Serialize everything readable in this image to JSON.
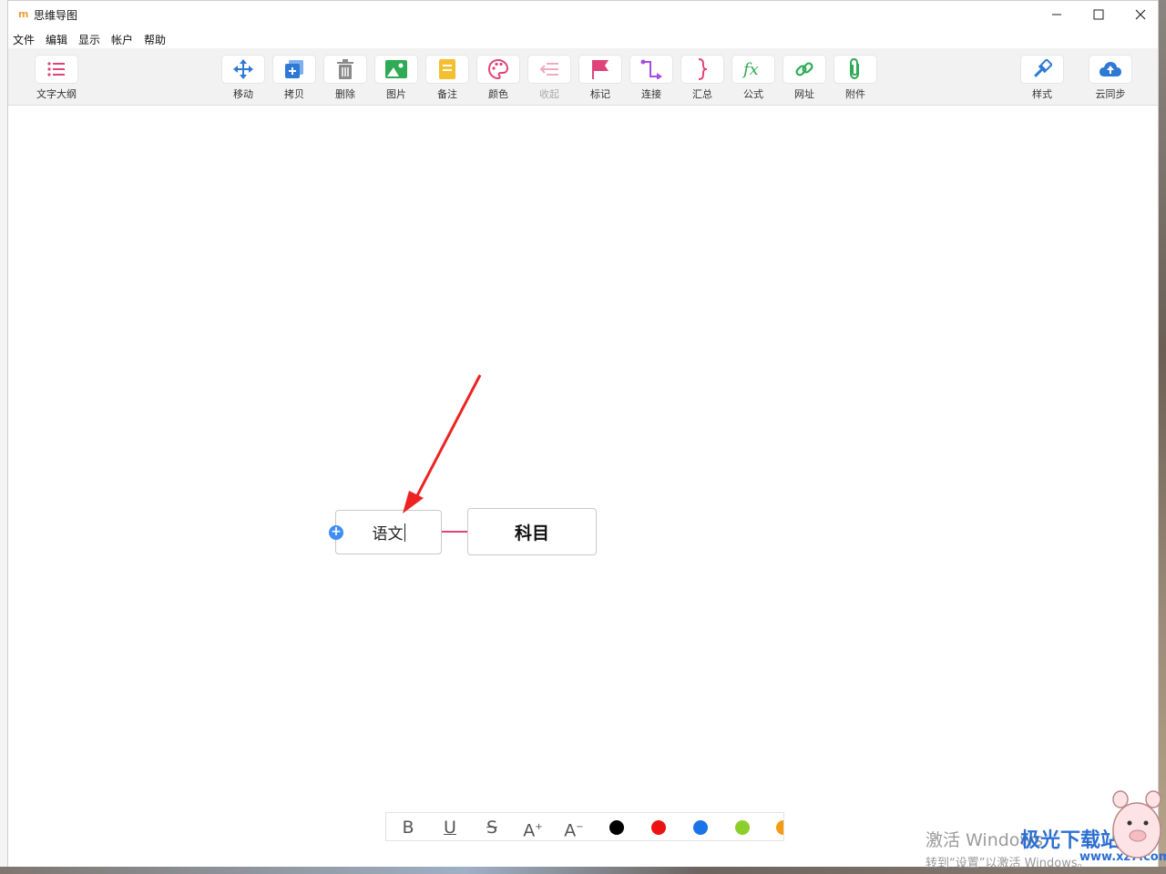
{
  "window": {
    "title": "思维导图",
    "logo": "m",
    "controls": [
      "minimize-icon",
      "maximize-icon",
      "close-icon"
    ]
  },
  "menu": [
    "文件",
    "编辑",
    "显示",
    "帐户",
    "帮助"
  ],
  "toolbar": {
    "outline": "文字大纲",
    "move": "移动",
    "copy": "拷贝",
    "delete": "删除",
    "image": "图片",
    "note": "备注",
    "color": "颜色",
    "collapse": "收起",
    "mark": "标记",
    "connect": "连接",
    "summary": "汇总",
    "formula": "公式",
    "url": "网址",
    "attach": "附件",
    "style": "样式",
    "cloud": "云同步"
  },
  "mindmap": {
    "root": "科目",
    "child": "语文",
    "connector_color": "#e0447a"
  },
  "format": {
    "bold": "B",
    "underline": "U",
    "strike": "S",
    "grow": "A",
    "shrink": "A",
    "swatches": [
      "#000000",
      "#ee1111",
      "#1a73e8",
      "#8ccf2b",
      "#f59a12"
    ]
  },
  "overlay": {
    "activation_title": "激活 Windows",
    "activation_sub": "转到“设置”以激活 Windows。",
    "brand": "极光下载站",
    "brand_url": "www.xz7.com"
  },
  "accent": "#e0447a"
}
